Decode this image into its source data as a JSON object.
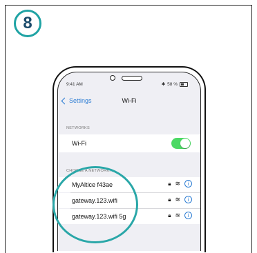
{
  "step": {
    "number": "8"
  },
  "status_bar": {
    "time": "9:41 AM",
    "bluetooth_icon": "bluetooth-icon",
    "battery_percent": "58 %"
  },
  "nav": {
    "back_label": "Settings",
    "title": "Wi-Fi"
  },
  "networks_section": {
    "header": "NETWORKS",
    "wifi_label": "Wi-Fi",
    "wifi_enabled": true
  },
  "choose_section": {
    "header": "CHOOSE A NETWORK..."
  },
  "networks": [
    {
      "name": "MyAltice f43ae",
      "secured": true,
      "icon_lock": "lock-icon",
      "icon_wifi": "wifi-icon"
    },
    {
      "name": "gateway.123.wifi",
      "secured": true,
      "icon_lock": "lock-icon",
      "icon_wifi": "wifi-icon"
    },
    {
      "name": "gateway.123.wifi 5g",
      "secured": true,
      "icon_lock": "lock-icon",
      "icon_wifi": "wifi-icon"
    }
  ],
  "colors": {
    "accent": "#1fa3a4",
    "ios_blue": "#2b7cd3",
    "toggle_on": "#4cd964",
    "step_text": "#1b4b6b"
  }
}
